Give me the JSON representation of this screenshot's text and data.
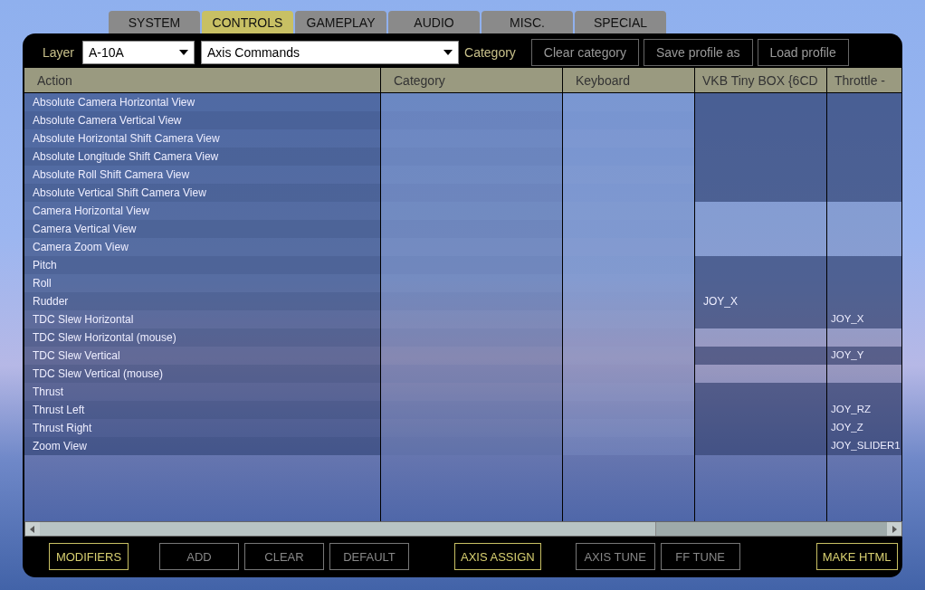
{
  "tabs": [
    {
      "label": "SYSTEM",
      "selected": false
    },
    {
      "label": "CONTROLS",
      "selected": true
    },
    {
      "label": "GAMEPLAY",
      "selected": false
    },
    {
      "label": "AUDIO",
      "selected": false
    },
    {
      "label": "MISC.",
      "selected": false
    },
    {
      "label": "SPECIAL",
      "selected": false
    }
  ],
  "toolbar": {
    "layer_label": "Layer",
    "layer_value": "A-10A",
    "category_value": "Axis Commands",
    "category_label": "Category",
    "buttons": [
      "Clear category",
      "Save profile as",
      "Load profile"
    ]
  },
  "table": {
    "columns": [
      "Action",
      "Category",
      "Keyboard",
      "VKB Tiny BOX  {6CD",
      "Throttle -"
    ],
    "rows": [
      {
        "action": "Absolute Camera Horizontal View",
        "device_axis": true,
        "vkb": "",
        "throttle": ""
      },
      {
        "action": "Absolute Camera Vertical View",
        "device_axis": true,
        "vkb": "",
        "throttle": ""
      },
      {
        "action": "Absolute Horizontal Shift Camera View",
        "device_axis": true,
        "vkb": "",
        "throttle": ""
      },
      {
        "action": "Absolute Longitude Shift Camera View",
        "device_axis": true,
        "vkb": "",
        "throttle": ""
      },
      {
        "action": "Absolute Roll Shift Camera View",
        "device_axis": true,
        "vkb": "",
        "throttle": ""
      },
      {
        "action": "Absolute Vertical Shift Camera View",
        "device_axis": true,
        "vkb": "",
        "throttle": ""
      },
      {
        "action": "Camera Horizontal View",
        "device_axis": false,
        "vkb": "",
        "throttle": ""
      },
      {
        "action": "Camera Vertical View",
        "device_axis": false,
        "vkb": "",
        "throttle": ""
      },
      {
        "action": "Camera Zoom View",
        "device_axis": false,
        "vkb": "",
        "throttle": ""
      },
      {
        "action": "Pitch",
        "device_axis": true,
        "vkb": "",
        "throttle": ""
      },
      {
        "action": "Roll",
        "device_axis": true,
        "vkb": "",
        "throttle": ""
      },
      {
        "action": "Rudder",
        "device_axis": true,
        "vkb": "JOY_X",
        "throttle": ""
      },
      {
        "action": "TDC Slew Horizontal",
        "device_axis": true,
        "vkb": "",
        "throttle": "JOY_X"
      },
      {
        "action": "TDC Slew Horizontal (mouse)",
        "device_axis": false,
        "vkb": "",
        "throttle": ""
      },
      {
        "action": "TDC Slew Vertical",
        "device_axis": true,
        "vkb": "",
        "throttle": "JOY_Y"
      },
      {
        "action": "TDC Slew Vertical (mouse)",
        "device_axis": false,
        "vkb": "",
        "throttle": ""
      },
      {
        "action": "Thrust",
        "device_axis": true,
        "vkb": "",
        "throttle": ""
      },
      {
        "action": "Thrust Left",
        "device_axis": true,
        "vkb": "",
        "throttle": "JOY_RZ"
      },
      {
        "action": "Thrust Right",
        "device_axis": true,
        "vkb": "",
        "throttle": "JOY_Z"
      },
      {
        "action": "Zoom View",
        "device_axis": true,
        "vkb": "",
        "throttle": "JOY_SLIDER1"
      }
    ]
  },
  "bottom_buttons": [
    {
      "label": "MODIFIERS",
      "disabled": false
    },
    {
      "label": "ADD",
      "disabled": true
    },
    {
      "label": "CLEAR",
      "disabled": true
    },
    {
      "label": "DEFAULT",
      "disabled": true
    },
    {
      "label": "AXIS ASSIGN",
      "disabled": false
    },
    {
      "label": "AXIS TUNE",
      "disabled": true
    },
    {
      "label": "FF TUNE",
      "disabled": true
    },
    {
      "label": "MAKE HTML",
      "disabled": false
    }
  ]
}
